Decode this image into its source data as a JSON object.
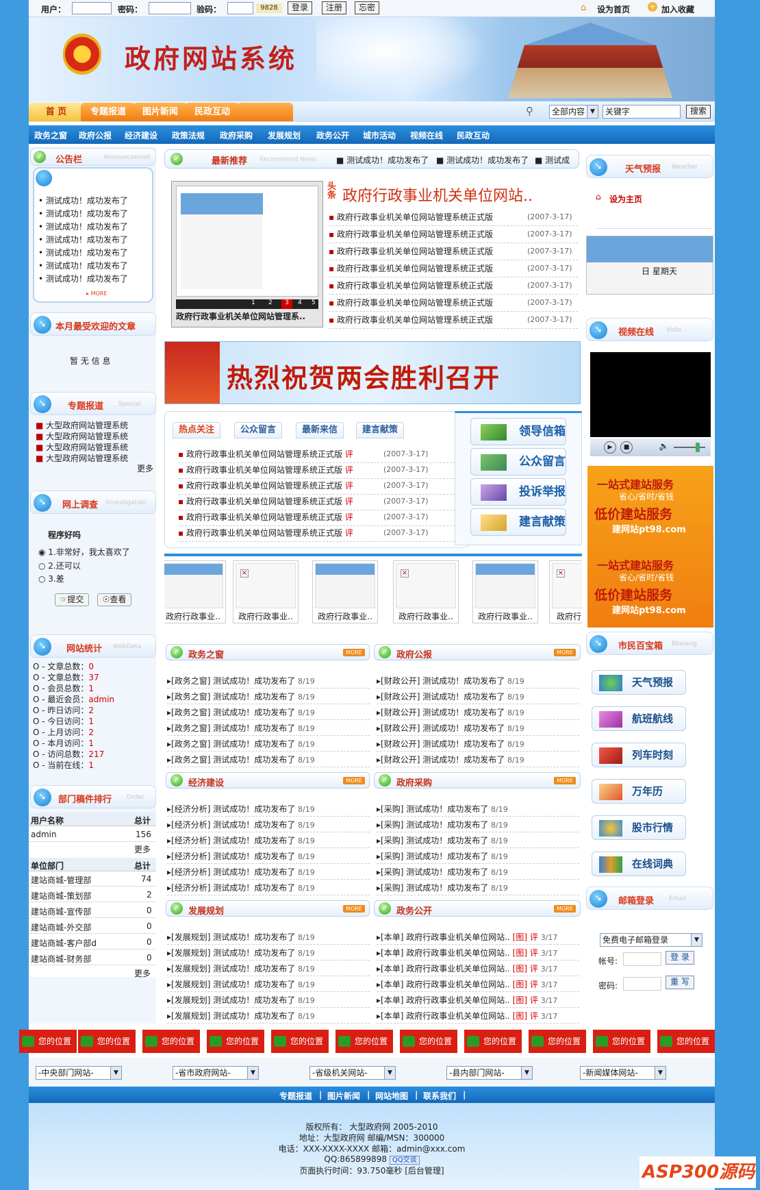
{
  "login": {
    "user_label": "用户：",
    "pass_label": "密码：",
    "code_label": "验码：",
    "captcha": "9828",
    "login_btn": "登录",
    "register_btn": "注册",
    "forgot_btn": "忘密",
    "set_home": "设为首页",
    "add_fav": "加入收藏"
  },
  "banner": {
    "title": "政府网站系统"
  },
  "tabs": [
    "首 页",
    "专题报道",
    "图片新闻",
    "民政互动"
  ],
  "search": {
    "scope": "全部内容",
    "keyword": "关键字",
    "button": "搜索"
  },
  "subnav": [
    "政务之窗",
    "政府公报",
    "经济建设",
    "政策法规",
    "政府采购",
    "发展规划",
    "政务公开",
    "城市活动",
    "视频在线",
    "民政互动"
  ],
  "notice": {
    "title": "公告栏",
    "en": "Announcement",
    "items": [
      "测试成功！成功发布了",
      "测试成功！成功发布了",
      "测试成功！成功发布了",
      "测试成功！成功发布了",
      "测试成功！成功发布了",
      "测试成功！成功发布了",
      "测试成功！成功发布了"
    ],
    "more": "MORE"
  },
  "popular": {
    "title": "本月最受欢迎的文章",
    "empty": "暂 无 信 息"
  },
  "special": {
    "title": "专题报道",
    "en": "Special",
    "items": [
      "大型政府网站管理系统",
      "大型政府网站管理系统",
      "大型政府网站管理系统",
      "大型政府网站管理系统"
    ],
    "more": "更多"
  },
  "survey": {
    "title": "网上调查",
    "en": "Investigation",
    "question": "程序好吗",
    "options": [
      "1.非常好，我太喜欢了",
      "2.还可以",
      "3.差"
    ],
    "submit": "提交",
    "view": "查看"
  },
  "stats": {
    "title": "网站统计",
    "en": "WebData",
    "rows": [
      {
        "label": "O - 文章总数：",
        "value": "0"
      },
      {
        "label": "O - 文章总数：",
        "value": "37"
      },
      {
        "label": "O - 会员总数：",
        "value": "1"
      },
      {
        "label": "O - 最近会员：",
        "value": "admin"
      },
      {
        "label": "O - 昨日访问：",
        "value": "2"
      },
      {
        "label": "O - 今日访问：",
        "value": "1"
      },
      {
        "label": "O - 上月访问：",
        "value": "2"
      },
      {
        "label": "O - 本月访问：",
        "value": "1"
      },
      {
        "label": "O - 访问总数：",
        "value": "217"
      },
      {
        "label": "O - 当前在线：",
        "value": "1"
      }
    ]
  },
  "ranking": {
    "title": "部门稿件排行",
    "en": "Order",
    "users_header": [
      "用户名称",
      "总计"
    ],
    "users": [
      [
        "admin",
        "156"
      ]
    ],
    "more1": "更多",
    "dept_header": [
      "单位部门",
      "总计"
    ],
    "depts": [
      [
        "建站商城-管理部",
        "74"
      ],
      [
        "建站商城-策划部",
        "2"
      ],
      [
        "建站商城-宣传部",
        "0"
      ],
      [
        "建站商城-外交部",
        "0"
      ],
      [
        "建站商城-客户部d",
        "0"
      ],
      [
        "建站商城-财务部",
        "0"
      ]
    ],
    "more2": "更多"
  },
  "recommend": {
    "title": "最新推荐",
    "en": "Recommend News",
    "ticker": [
      "测试成功！成功发布了",
      "测试成功！成功发布了",
      "测试成"
    ]
  },
  "slide": {
    "caption": "政府行政事业机关单位网站管理系..",
    "nums": [
      "1",
      "2",
      "3",
      "4",
      "5"
    ]
  },
  "headline": {
    "tag1": "头",
    "tag2": "条",
    "title": "政府行政事业机关单位网站..",
    "items": [
      [
        "政府行政事业机关单位网站管理系统正式版",
        "(2007-3-17)"
      ],
      [
        "政府行政事业机关单位网站管理系统正式版",
        "(2007-3-17)"
      ],
      [
        "政府行政事业机关单位网站管理系统正式版",
        "(2007-3-17)"
      ],
      [
        "政府行政事业机关单位网站管理系统正式版",
        "(2007-3-17)"
      ],
      [
        "政府行政事业机关单位网站管理系统正式版",
        "(2007-3-17)"
      ],
      [
        "政府行政事业机关单位网站管理系统正式版",
        "(2007-3-17)"
      ],
      [
        "政府行政事业机关单位网站管理系统正式版",
        "(2007-3-17)"
      ]
    ]
  },
  "ad": {
    "text": "热烈祝贺两会胜利召开"
  },
  "hot": {
    "tabs": [
      "热点关注",
      "公众留言",
      "最新来信",
      "建言献策"
    ],
    "comment": "评",
    "items": [
      [
        "政府行政事业机关单位网站管理系统正式版",
        "(2007-3-17)"
      ],
      [
        "政府行政事业机关单位网站管理系统正式版",
        "(2007-3-17)"
      ],
      [
        "政府行政事业机关单位网站管理系统正式版",
        "(2007-3-17)"
      ],
      [
        "政府行政事业机关单位网站管理系统正式版",
        "(2007-3-17)"
      ],
      [
        "政府行政事业机关单位网站管理系统正式版",
        "(2007-3-17)"
      ],
      [
        "政府行政事业机关单位网站管理系统正式版",
        "(2007-3-17)"
      ]
    ]
  },
  "mailbox": [
    "领导信箱",
    "公众留言",
    "投诉举报",
    "建言献策"
  ],
  "thumbs": [
    "政府行政事业..",
    "政府行政事业..",
    "政府行政事业..",
    "政府行政事业..",
    "政府行政事业..",
    "政府行"
  ],
  "sections": [
    {
      "title": "政务之窗",
      "more": "MORE",
      "items": [
        "[政务之窗] 测试成功！成功发布了",
        "[政务之窗] 测试成功！成功发布了",
        "[政务之窗] 测试成功！成功发布了",
        "[政务之窗] 测试成功！成功发布了",
        "[政务之窗] 测试成功！成功发布了",
        "[政务之窗] 测试成功！成功发布了"
      ],
      "date": "8/19"
    },
    {
      "title": "政府公报",
      "more": "MORE",
      "items": [
        "[财政公开] 测试成功！成功发布了",
        "[财政公开] 测试成功！成功发布了",
        "[财政公开] 测试成功！成功发布了",
        "[财政公开] 测试成功！成功发布了",
        "[财政公开] 测试成功！成功发布了",
        "[财政公开] 测试成功！成功发布了"
      ],
      "date": "8/19"
    },
    {
      "title": "经济建设",
      "more": "MORE",
      "items": [
        "[经济分析] 测试成功！成功发布了",
        "[经济分析] 测试成功！成功发布了",
        "[经济分析] 测试成功！成功发布了",
        "[经济分析] 测试成功！成功发布了",
        "[经济分析] 测试成功！成功发布了",
        "[经济分析] 测试成功！成功发布了"
      ],
      "date": "8/19"
    },
    {
      "title": "政府采购",
      "more": "MORE",
      "items": [
        "[采购] 测试成功！成功发布了",
        "[采购] 测试成功！成功发布了",
        "[采购] 测试成功！成功发布了",
        "[采购] 测试成功！成功发布了",
        "[采购] 测试成功！成功发布了",
        "[采购] 测试成功！成功发布了"
      ],
      "date": "8/19"
    },
    {
      "title": "发展规划",
      "more": "MORE",
      "items": [
        "[发展规划] 测试成功！成功发布了",
        "[发展规划] 测试成功！成功发布了",
        "[发展规划] 测试成功！成功发布了",
        "[发展规划] 测试成功！成功发布了",
        "[发展规划] 测试成功！成功发布了",
        "[发展规划] 测试成功！成功发布了"
      ],
      "date": "8/19"
    },
    {
      "title": "政务公开",
      "more": "MORE",
      "items": [
        "[本单] 政府行政事业机关单位网站..",
        "[本单] 政府行政事业机关单位网站..",
        "[本单] 政府行政事业机关单位网站..",
        "[本单] 政府行政事业机关单位网站..",
        "[本单] 政府行政事业机关单位网站..",
        "[本单] 政府行政事业机关单位网站.."
      ],
      "tag": "[图]",
      "cm": "评",
      "date": "3/17"
    }
  ],
  "weather": {
    "title": "天气预报",
    "en": "Weather",
    "set_home": "设为主页",
    "date_text": "日 星期天"
  },
  "video": {
    "title": "视频在线",
    "en": "Vidio"
  },
  "promo": {
    "line1": "一站式建站服务",
    "line2": "省心/省时/省钱",
    "line3": "低价建站服务",
    "line4": "建网站pt98.com"
  },
  "services": {
    "title": "市民百宝箱",
    "en": "Bhxiang",
    "items": [
      "天气预报",
      "航班航线",
      "列车时刻",
      "万年历",
      "股市行情",
      "在线词典"
    ]
  },
  "email": {
    "title": "邮箱登录",
    "en": "Email",
    "select": "免费电子邮箱登录",
    "account_label": "帐号:",
    "password_label": "密码:",
    "login": "登 录",
    "reset": "重 写"
  },
  "position_label": "您的位置",
  "selects": [
    "-中央部门网站-",
    "-省市政府网站-",
    "-省级机关网站-",
    "-县内部门网站-",
    "-新闻媒体网站-"
  ],
  "footer_nav": [
    "专题报道",
    "图片新闻",
    "网站地图",
    "联系我们"
  ],
  "footer": {
    "l1": "版权所有： 大型政府网 2005-2010",
    "l2": "地址：大型政府网 邮编/MSN：300000",
    "l3": "电话：XXX-XXXX-XXXX 邮箱：admin@xxx.com",
    "l4": "QQ:865899898",
    "l4b": "QQ交谈",
    "l5": "页面执行时间：93.750毫秒 [后台管理]"
  },
  "watermark": "ASP300源码"
}
